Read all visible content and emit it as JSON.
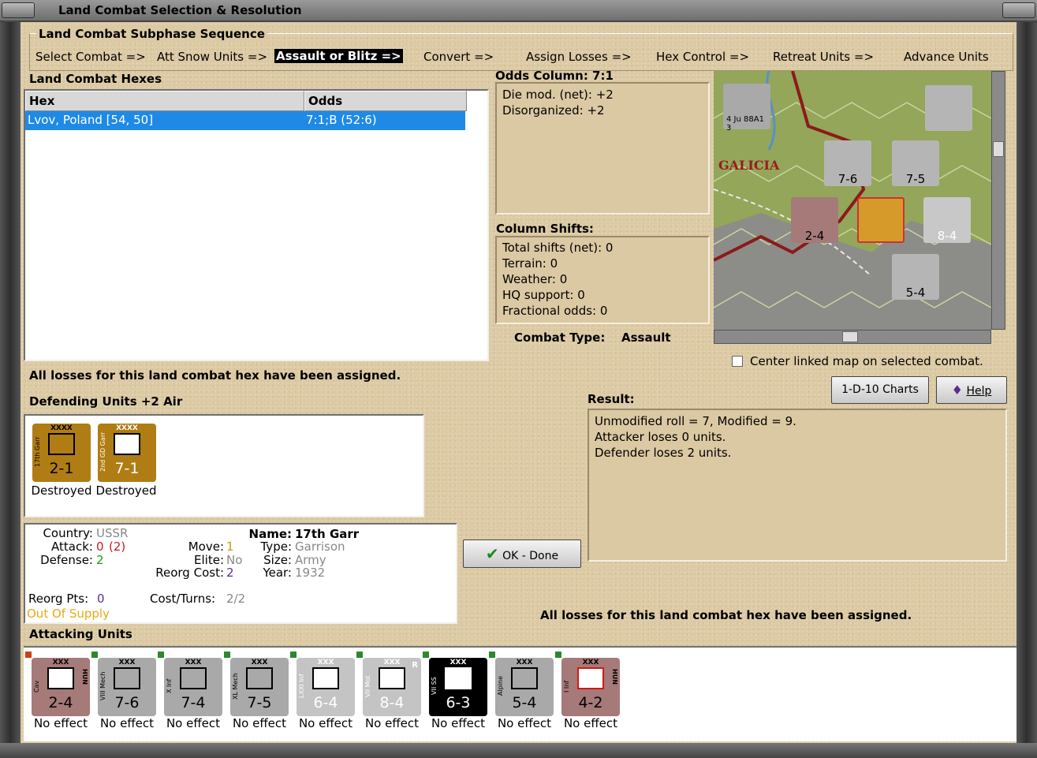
{
  "window": {
    "title": "Land Combat Selection & Resolution"
  },
  "sequence": {
    "title": "Land Combat Subphase Sequence",
    "steps": [
      "Select Combat =>",
      "Att Snow Units =>",
      "Assault or Blitz =>",
      "Convert =>",
      "Assign Losses =>",
      "Hex Control =>",
      "Retreat Units =>",
      "Advance Units"
    ],
    "active_index": 2
  },
  "hexes": {
    "title": "Land Combat Hexes",
    "columns": [
      "Hex",
      "Odds"
    ],
    "rows": [
      {
        "hex": "Lvov, Poland [54, 50]",
        "odds": "7:1;B (52:6)"
      }
    ],
    "status": "All losses for this land combat hex have been assigned."
  },
  "odds": {
    "title": "Odds Column: 7:1",
    "lines": [
      "Die mod. (net): +2",
      "Disorganized: +2"
    ]
  },
  "shifts": {
    "title": "Column Shifts:",
    "lines": [
      "Total shifts (net): 0",
      "Terrain: 0",
      "Weather: 0",
      "HQ support: 0",
      "Fractional odds: 0"
    ]
  },
  "combat_type": {
    "label": "Combat Type:",
    "value": "Assault"
  },
  "map": {
    "region_label": "GALICIA",
    "center_checkbox_label": "Center linked map on selected combat."
  },
  "buttons": {
    "charts": "1-D-10 Charts",
    "help": "Help",
    "ok": "OK - Done"
  },
  "defenders": {
    "title": "Defending Units +2 Air",
    "units": [
      {
        "name": "17th Garr",
        "size": "XXXX",
        "strength": "2-1",
        "status": "Destroyed"
      },
      {
        "name": "2nd GD Garr",
        "size": "XXXX",
        "strength": "7-1",
        "status": "Destroyed"
      }
    ]
  },
  "unit_info": {
    "country_label": "Country:",
    "country": "USSR",
    "attack_label": "Attack:",
    "attack": "0",
    "attack_alt": "(2)",
    "defense_label": "Defense:",
    "defense": "2",
    "move_label": "Move:",
    "move": "1",
    "elite_label": "Elite:",
    "elite": "No",
    "reorg_cost_label": "Reorg Cost:",
    "reorg_cost": "2",
    "name_label": "Name:",
    "name": "17th Garr",
    "type_label": "Type:",
    "type": "Garrison",
    "size_label": "Size:",
    "size": "Army",
    "year_label": "Year:",
    "year": "1932",
    "reorg_pts_label": "Reorg Pts:",
    "reorg_pts": "0",
    "cost_turns_label": "Cost/Turns:",
    "cost_turns": "2/2",
    "supply": "Out Of Supply"
  },
  "result": {
    "title": "Result:",
    "lines": [
      "Unmodified roll = 7, Modified = 9.",
      "Attacker loses 0 units.",
      "Defender loses 2 units."
    ],
    "status": "All losses for this land combat hex have been assigned."
  },
  "attackers": {
    "title": "Attacking Units",
    "units": [
      {
        "name": "Cav",
        "nation": "HUN",
        "size": "XXX",
        "strength": "2-4",
        "status": "No effect"
      },
      {
        "name": "VIII Mech",
        "size": "XXX",
        "strength": "7-6",
        "status": "No effect"
      },
      {
        "name": "X Inf",
        "size": "XXX",
        "strength": "7-4",
        "status": "No effect"
      },
      {
        "name": "XL Mech",
        "size": "XXX",
        "strength": "7-5",
        "status": "No effect"
      },
      {
        "name": "LXXI Inf",
        "size": "XXX",
        "strength": "6-4",
        "status": "No effect"
      },
      {
        "name": "VII Mot",
        "size": "XXX",
        "strength": "8-4",
        "reserve": "R",
        "status": "No effect"
      },
      {
        "name": "VII SS",
        "size": "XXX",
        "strength": "6-3",
        "status": "No effect"
      },
      {
        "name": "Alpine",
        "size": "XXX",
        "strength": "5-4",
        "status": "No effect"
      },
      {
        "name": "I Inf",
        "nation": "HUN",
        "size": "XXX",
        "strength": "4-2",
        "status": "No effect"
      }
    ]
  },
  "colors": {
    "client_bg": "#dccaa4",
    "selection": "#1e8ae6",
    "soviet_counter": "#b07d14",
    "german_counter": "#a9a9a9",
    "hungarian_counter": "#a57a78",
    "ss_counter": "#000000"
  }
}
